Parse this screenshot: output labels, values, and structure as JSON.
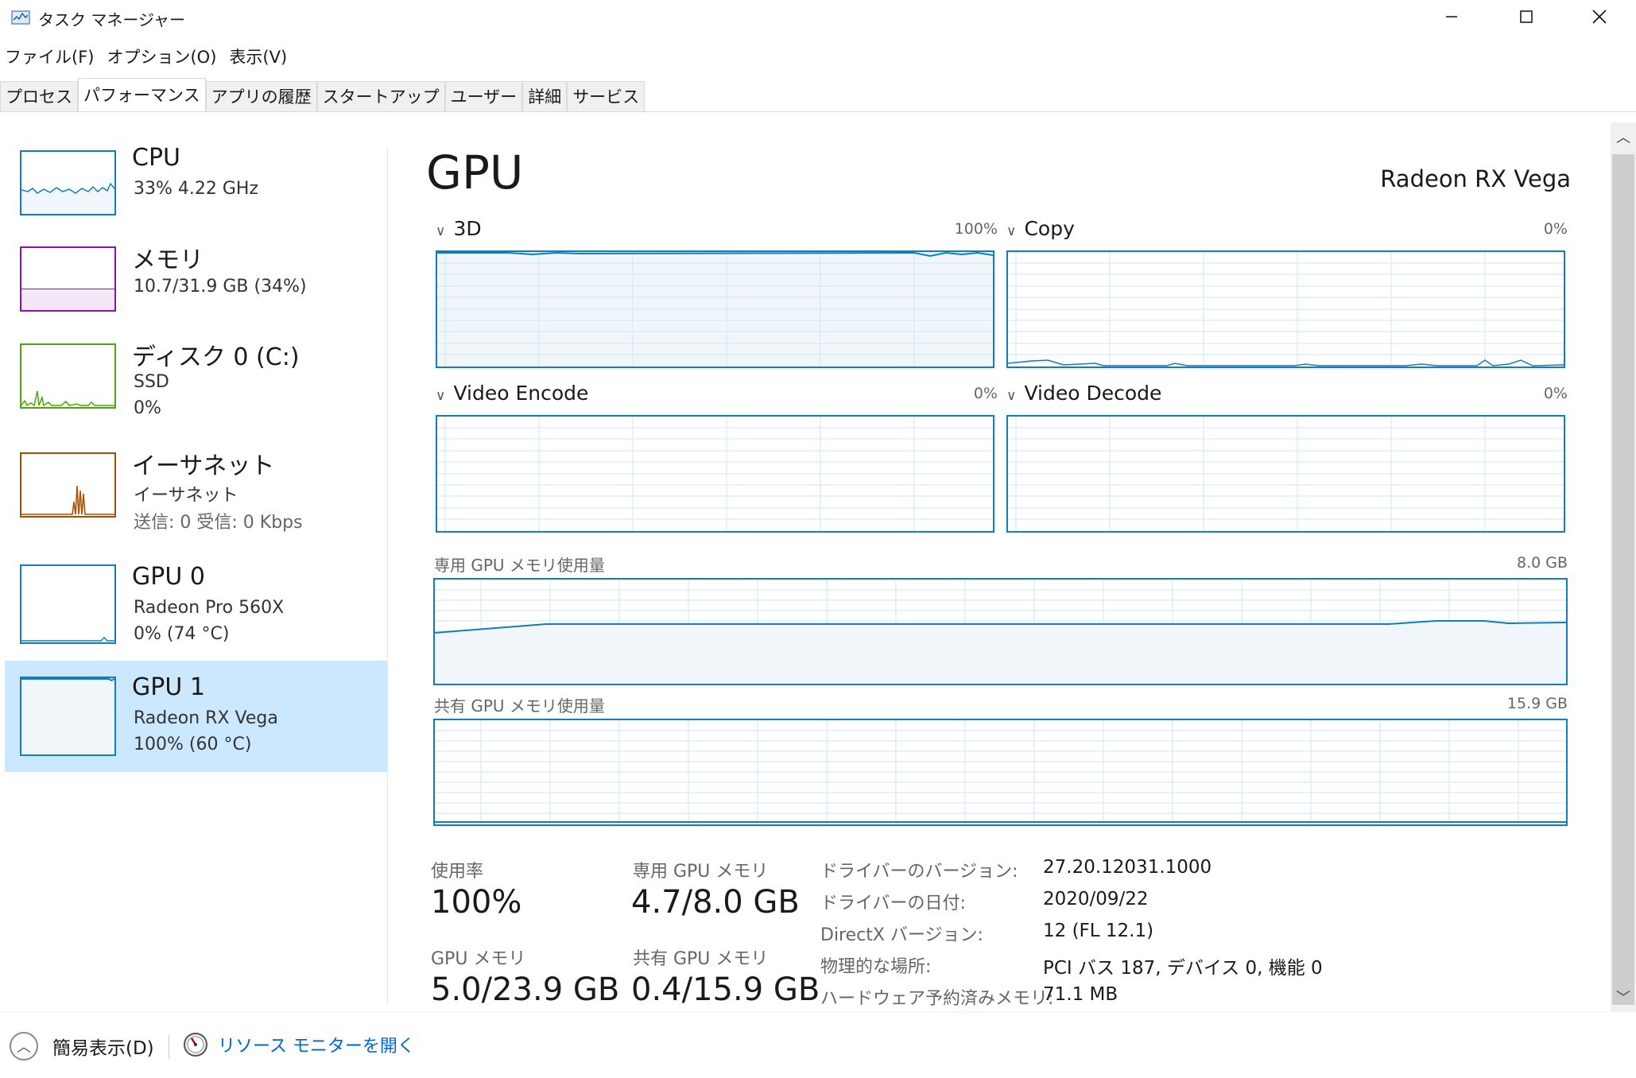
{
  "window": {
    "title": "タスク マネージャー",
    "minimize_icon": "minimize-icon",
    "maximize_icon": "maximize-icon",
    "close_icon": "close-icon"
  },
  "menu": [
    "ファイル(F)",
    "オプション(O)",
    "表示(V)"
  ],
  "tabs": [
    {
      "label": "プロセス",
      "active": false
    },
    {
      "label": "パフォーマンス",
      "active": true
    },
    {
      "label": "アプリの履歴",
      "active": false
    },
    {
      "label": "スタートアップ",
      "active": false
    },
    {
      "label": "ユーザー",
      "active": false
    },
    {
      "label": "詳細",
      "active": false
    },
    {
      "label": "サービス",
      "active": false
    }
  ],
  "sidebar": {
    "items": [
      {
        "title": "CPU",
        "line1": "33%  4.22 GHz",
        "line2": "",
        "color": "#117dbb"
      },
      {
        "title": "メモリ",
        "line1": "10.7/31.9 GB (34%)",
        "line2": "",
        "color": "#8b12ae",
        "fill": 0.34
      },
      {
        "title": "ディスク 0 (C:)",
        "line1": "SSD",
        "line2": "0%",
        "color": "#4da60c"
      },
      {
        "title": "イーサネット",
        "line1": "イーサネット",
        "line2": "送信: 0  受信: 0 Kbps",
        "color": "#a74f01"
      },
      {
        "title": "GPU 0",
        "line1": "Radeon Pro 560X",
        "line2": "0%  (74 °C)",
        "color": "#117dbb"
      },
      {
        "title": "GPU 1",
        "line1": "Radeon RX Vega",
        "line2": "100%  (60 °C)",
        "color": "#117dbb",
        "selected": true
      }
    ]
  },
  "main": {
    "title": "GPU",
    "device": "Radeon RX Vega",
    "engines": [
      {
        "name": "3D",
        "percent": "100%"
      },
      {
        "name": "Copy",
        "percent": "0%"
      },
      {
        "name": "Video Encode",
        "percent": "0%"
      },
      {
        "name": "Video Decode",
        "percent": "0%"
      }
    ],
    "dedicated": {
      "label": "専用 GPU メモリ使用量",
      "max": "8.0 GB"
    },
    "shared": {
      "label": "共有 GPU メモリ使用量",
      "max": "15.9 GB"
    },
    "stats": {
      "utilization_label": "使用率",
      "utilization_value": "100%",
      "dedicated_label": "専用 GPU メモリ",
      "dedicated_value": "4.7/8.0 GB",
      "gpu_mem_label": "GPU メモリ",
      "gpu_mem_value": "5.0/23.9 GB",
      "shared_label": "共有 GPU メモリ",
      "shared_value": "0.4/15.9 GB"
    },
    "info": [
      {
        "label": "ドライバーのバージョン:",
        "value": "27.20.12031.1000"
      },
      {
        "label": "ドライバーの日付:",
        "value": "2020/09/22"
      },
      {
        "label": "DirectX バージョン:",
        "value": "12 (FL 12.1)"
      },
      {
        "label": "物理的な場所:",
        "value": "PCI バス 187, デバイス 0, 機能 0"
      },
      {
        "label": "ハードウェア予約済みメモリ:",
        "value": "71.1 MB"
      }
    ]
  },
  "footer": {
    "fewer_details": "簡易表示(D)",
    "resource_monitor": "リソース モニターを開く"
  }
}
